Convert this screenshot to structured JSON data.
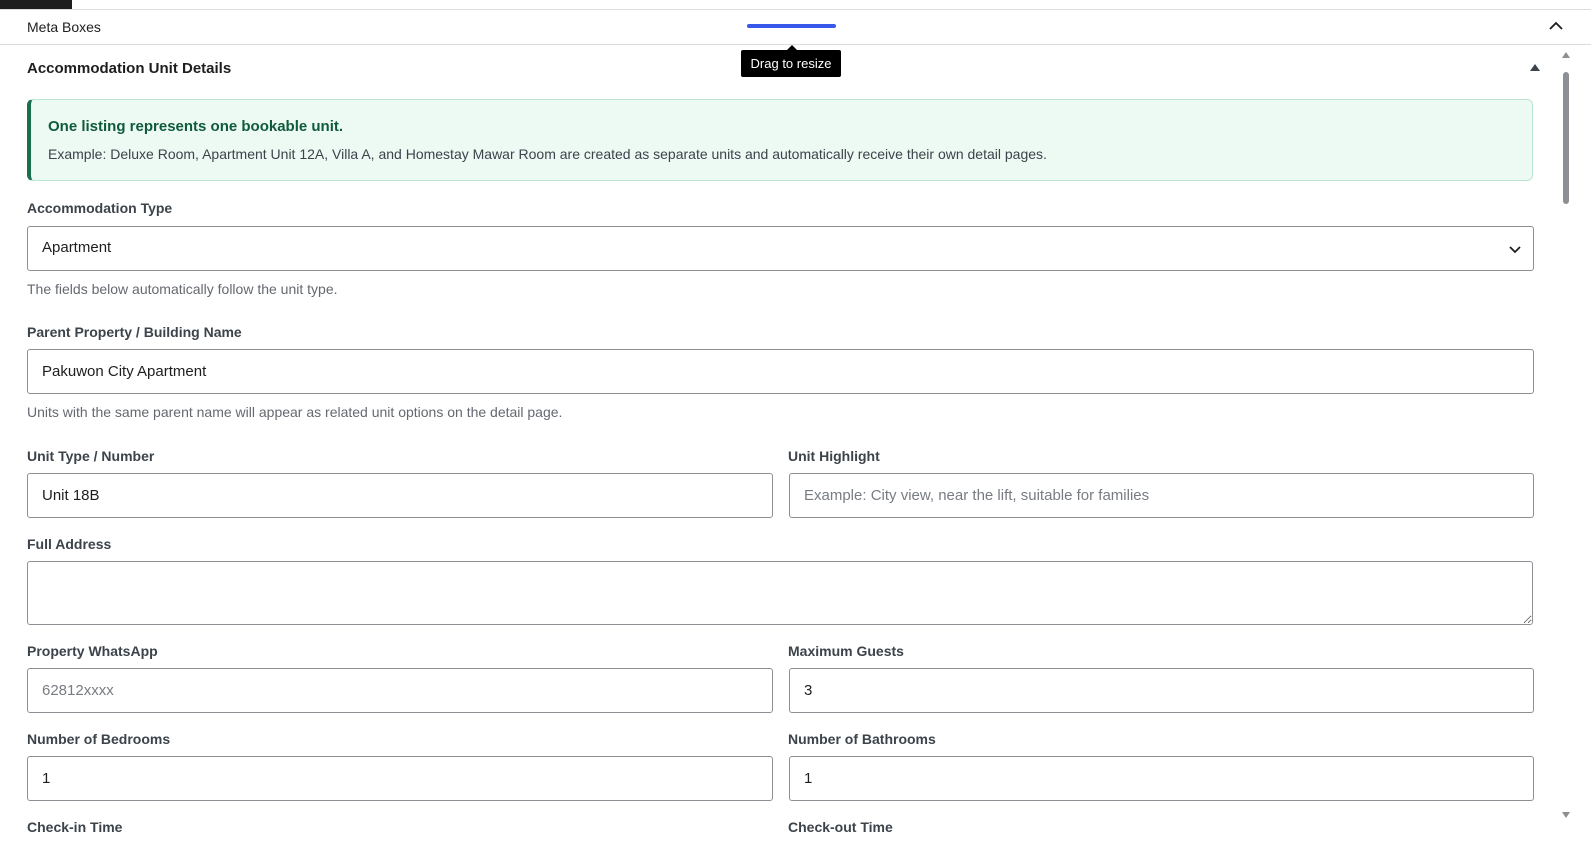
{
  "meta_boxes": {
    "title": "Meta Boxes",
    "resize_tooltip": "Drag to resize"
  },
  "panel": {
    "title": "Accommodation Unit Details"
  },
  "notice": {
    "title": "One listing represents one bookable unit.",
    "text": "Example: Deluxe Room, Apartment Unit 12A, Villa A, and Homestay Mawar Room are created as separate units and automatically receive their own detail pages."
  },
  "accommodation_type": {
    "label": "Accommodation Type",
    "selected": "Apartment",
    "help": "The fields below automatically follow the unit type."
  },
  "parent_property": {
    "label": "Parent Property / Building Name",
    "value": "Pakuwon City Apartment",
    "help": "Units with the same parent name will appear as related unit options on the detail page."
  },
  "unit_type": {
    "label": "Unit Type / Number",
    "value": "Unit 18B"
  },
  "unit_highlight": {
    "label": "Unit Highlight",
    "value": "",
    "placeholder": "Example: City view, near the lift, suitable for families"
  },
  "full_address": {
    "label": "Full Address",
    "value": ""
  },
  "property_whatsapp": {
    "label": "Property WhatsApp",
    "value": "",
    "placeholder": "62812xxxx"
  },
  "maximum_guests": {
    "label": "Maximum Guests",
    "value": "3"
  },
  "bedrooms": {
    "label": "Number of Bedrooms",
    "value": "1"
  },
  "bathrooms": {
    "label": "Number of Bathrooms",
    "value": "1"
  },
  "check_in": {
    "label": "Check-in Time"
  },
  "check_out": {
    "label": "Check-out Time"
  },
  "colors": {
    "accent": "#3858e9",
    "notice_bg": "#edfaf4",
    "notice_border": "#1a6e4d"
  }
}
